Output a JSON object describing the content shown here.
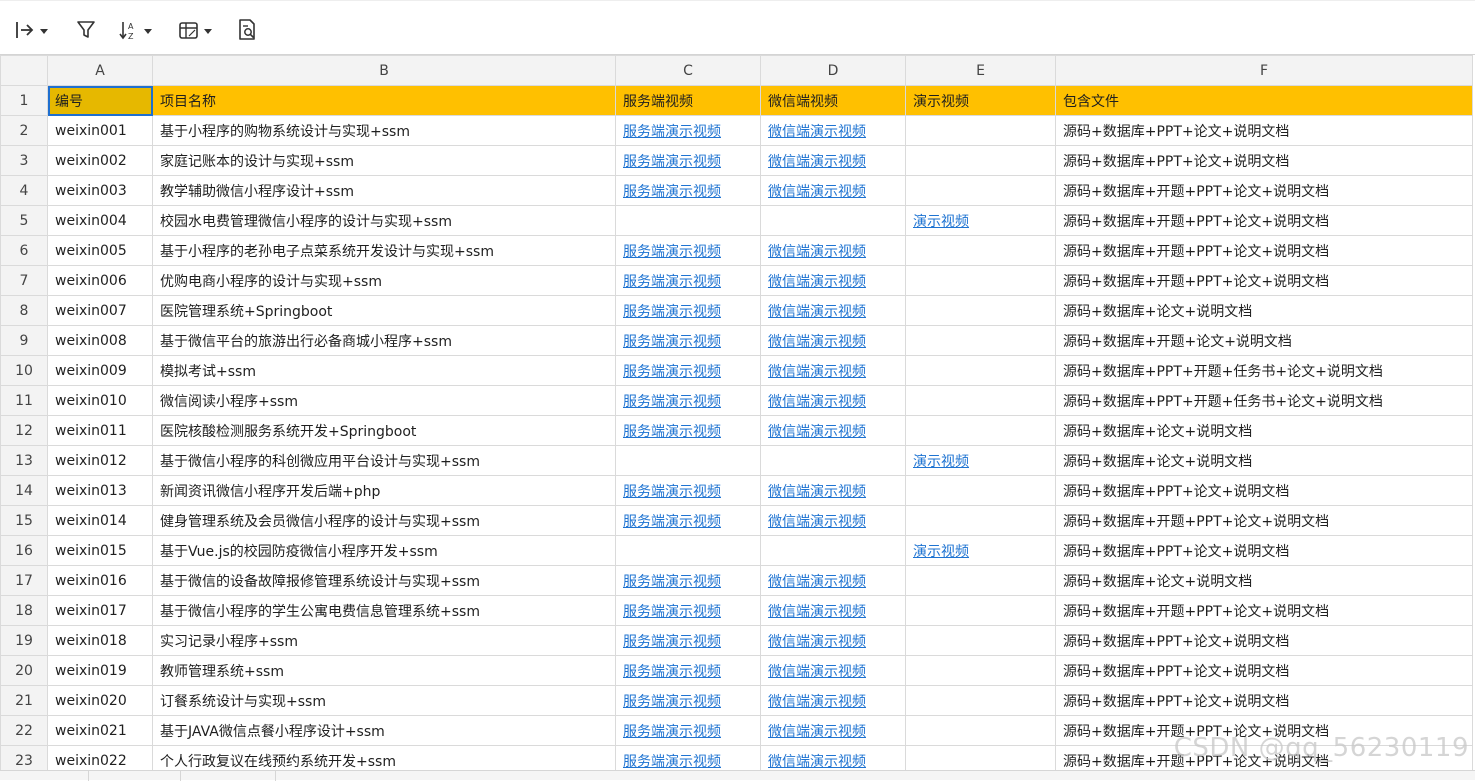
{
  "toolbar": {
    "icons": [
      "freeze-panes-icon",
      "filter-icon",
      "sort-icon",
      "cell-format-icon",
      "find-icon"
    ]
  },
  "columns": [
    "A",
    "B",
    "C",
    "D",
    "E",
    "F"
  ],
  "rows": [
    {
      "n": "1",
      "id": "编号",
      "name": "项目名称",
      "c": "服务端视频",
      "d": "微信端视频",
      "e": "演示视频",
      "f": "包含文件"
    },
    {
      "n": "2",
      "id": "weixin001",
      "name": "基于小程序的购物系统设计与实现+ssm",
      "c": "服务端演示视频",
      "d": "微信端演示视频",
      "e": "",
      "f": "源码+数据库+PPT+论文+说明文档"
    },
    {
      "n": "3",
      "id": "weixin002",
      "name": "家庭记账本的设计与实现+ssm",
      "c": "服务端演示视频",
      "d": "微信端演示视频",
      "e": "",
      "f": "源码+数据库+PPT+论文+说明文档"
    },
    {
      "n": "4",
      "id": "weixin003",
      "name": "教学辅助微信小程序设计+ssm",
      "c": "服务端演示视频",
      "d": "微信端演示视频",
      "e": "",
      "f": "源码+数据库+开题+PPT+论文+说明文档"
    },
    {
      "n": "5",
      "id": "weixin004",
      "name": "校园水电费管理微信小程序的设计与实现+ssm",
      "c": "",
      "d": "",
      "e": "演示视频",
      "f": "源码+数据库+开题+PPT+论文+说明文档"
    },
    {
      "n": "6",
      "id": "weixin005",
      "name": "基于小程序的老孙电子点菜系统开发设计与实现+ssm",
      "c": "服务端演示视频",
      "d": "微信端演示视频",
      "e": "",
      "f": "源码+数据库+开题+PPT+论文+说明文档"
    },
    {
      "n": "7",
      "id": "weixin006",
      "name": "优购电商小程序的设计与实现+ssm",
      "c": "服务端演示视频",
      "d": "微信端演示视频",
      "e": "",
      "f": "源码+数据库+开题+PPT+论文+说明文档"
    },
    {
      "n": "8",
      "id": "weixin007",
      "name": "医院管理系统+Springboot",
      "c": "服务端演示视频",
      "d": "微信端演示视频",
      "e": "",
      "f": "源码+数据库+论文+说明文档"
    },
    {
      "n": "9",
      "id": "weixin008",
      "name": "基于微信平台的旅游出行必备商城小程序+ssm",
      "c": "服务端演示视频",
      "d": "微信端演示视频",
      "e": "",
      "f": "源码+数据库+开题+论文+说明文档"
    },
    {
      "n": "10",
      "id": "weixin009",
      "name": "模拟考试+ssm",
      "c": "服务端演示视频",
      "d": "微信端演示视频",
      "e": "",
      "f": "源码+数据库+PPT+开题+任务书+论文+说明文档"
    },
    {
      "n": "11",
      "id": "weixin010",
      "name": "微信阅读小程序+ssm",
      "c": "服务端演示视频",
      "d": "微信端演示视频",
      "e": "",
      "f": "源码+数据库+PPT+开题+任务书+论文+说明文档"
    },
    {
      "n": "12",
      "id": "weixin011",
      "name": "医院核酸检测服务系统开发+Springboot",
      "c": "服务端演示视频",
      "d": "微信端演示视频",
      "e": "",
      "f": "源码+数据库+论文+说明文档"
    },
    {
      "n": "13",
      "id": "weixin012",
      "name": "基于微信小程序的科创微应用平台设计与实现+ssm",
      "c": "",
      "d": "",
      "e": "演示视频",
      "f": "源码+数据库+论文+说明文档"
    },
    {
      "n": "14",
      "id": "weixin013",
      "name": "新闻资讯微信小程序开发后端+php",
      "c": "服务端演示视频",
      "d": "微信端演示视频",
      "e": "",
      "f": "源码+数据库+PPT+论文+说明文档"
    },
    {
      "n": "15",
      "id": "weixin014",
      "name": "健身管理系统及会员微信小程序的设计与实现+ssm",
      "c": "服务端演示视频",
      "d": "微信端演示视频",
      "e": "",
      "f": "源码+数据库+开题+PPT+论文+说明文档"
    },
    {
      "n": "16",
      "id": "weixin015",
      "name": "基于Vue.js的校园防疫微信小程序开发+ssm",
      "c": "",
      "d": "",
      "e": "演示视频",
      "f": "源码+数据库+PPT+论文+说明文档"
    },
    {
      "n": "17",
      "id": "weixin016",
      "name": "基于微信的设备故障报修管理系统设计与实现+ssm",
      "c": "服务端演示视频",
      "d": "微信端演示视频",
      "e": "",
      "f": "源码+数据库+论文+说明文档"
    },
    {
      "n": "18",
      "id": "weixin017",
      "name": "基于微信小程序的学生公寓电费信息管理系统+ssm",
      "c": "服务端演示视频",
      "d": "微信端演示视频",
      "e": "",
      "f": "源码+数据库+开题+PPT+论文+说明文档"
    },
    {
      "n": "19",
      "id": "weixin018",
      "name": "实习记录小程序+ssm",
      "c": "服务端演示视频",
      "d": "微信端演示视频",
      "e": "",
      "f": "源码+数据库+PPT+论文+说明文档"
    },
    {
      "n": "20",
      "id": "weixin019",
      "name": "教师管理系统+ssm",
      "c": "服务端演示视频",
      "d": "微信端演示视频",
      "e": "",
      "f": "源码+数据库+PPT+论文+说明文档"
    },
    {
      "n": "21",
      "id": "weixin020",
      "name": "订餐系统设计与实现+ssm",
      "c": "服务端演示视频",
      "d": "微信端演示视频",
      "e": "",
      "f": "源码+数据库+PPT+论文+说明文档"
    },
    {
      "n": "22",
      "id": "weixin021",
      "name": "基于JAVA微信点餐小程序设计+ssm",
      "c": "服务端演示视频",
      "d": "微信端演示视频",
      "e": "",
      "f": "源码+数据库+开题+PPT+论文+说明文档"
    },
    {
      "n": "23",
      "id": "weixin022",
      "name": "个人行政复议在线预约系统开发+ssm",
      "c": "服务端演示视频",
      "d": "微信端演示视频",
      "e": "",
      "f": "源码+数据库+开题+PPT+论文+说明文档"
    }
  ],
  "watermark": "CSDN @qq_56230119",
  "colors": {
    "header_fill": "#ffc000",
    "link": "#1e73d2",
    "selection": "#1f6fcf"
  }
}
